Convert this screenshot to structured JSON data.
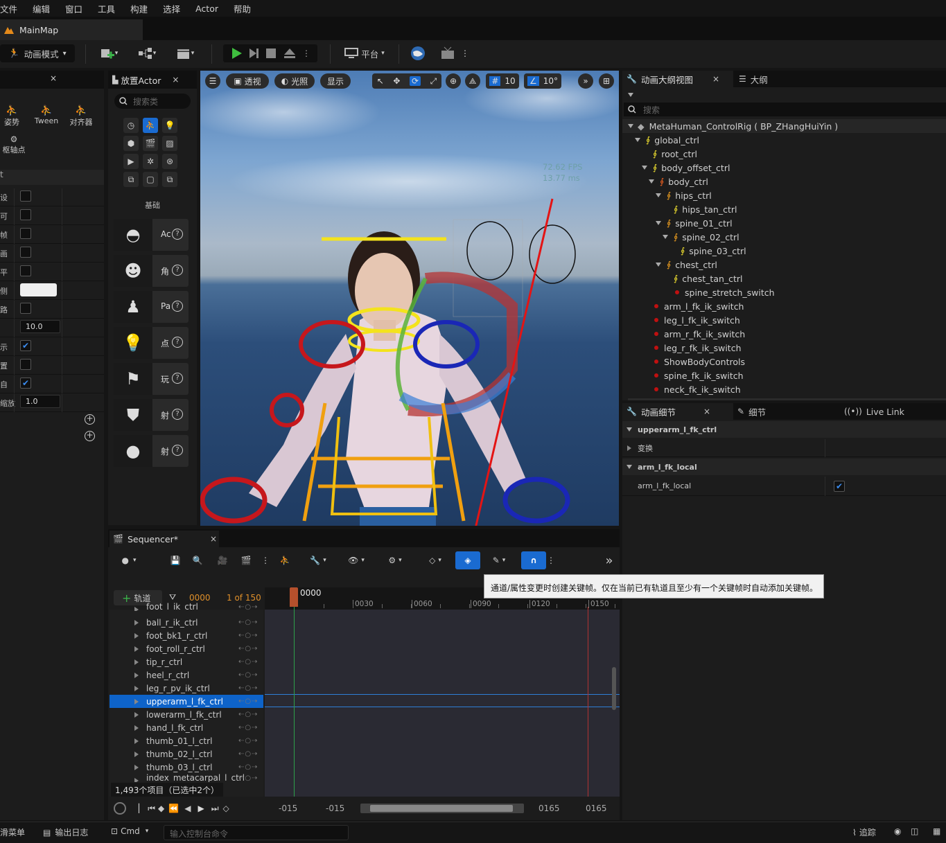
{
  "menu": [
    "文件",
    "编辑",
    "窗口",
    "工具",
    "构建",
    "选择",
    "Actor",
    "帮助"
  ],
  "map_tab": "MainMap",
  "toolbar": {
    "mode": "动画模式",
    "platform": "平台"
  },
  "left_panel": {
    "tools": [
      "姿势",
      "Tween",
      "对齐器"
    ],
    "pivot": "枢轴点",
    "section_header": "t",
    "field_10": "10.0",
    "field_1": "1.0",
    "prop_prefixes": [
      "设",
      "可",
      "帧",
      "画",
      "平",
      "侧",
      "路",
      "",
      "示",
      "置",
      "自",
      "缩放"
    ]
  },
  "place_actor": {
    "title": "放置Actor",
    "search_placeholder": "搜索类",
    "category": "基础",
    "items": [
      "Ac",
      "角",
      "Pa",
      "点",
      "玩",
      "射",
      "射"
    ]
  },
  "viewport": {
    "buttons": {
      "perspective": "透视",
      "lit": "光照",
      "show": "显示",
      "grid": "10",
      "angle": "10°"
    },
    "fps": "72.62 FPS",
    "ms": "13.77 ms"
  },
  "outliner": {
    "tab1": "动画大纲视图",
    "tab2": "大纲",
    "search_placeholder": "搜索",
    "root": "MetaHuman_ControlRig ( BP_ZHangHuiYin )",
    "items": [
      "global_ctrl",
      "root_ctrl",
      "body_offset_ctrl",
      "body_ctrl",
      "hips_ctrl",
      "hips_tan_ctrl",
      "spine_01_ctrl",
      "spine_02_ctrl",
      "spine_03_ctrl",
      "chest_ctrl",
      "chest_tan_ctrl",
      "spine_stretch_switch",
      "arm_l_fk_ik_switch",
      "leg_l_fk_ik_switch",
      "arm_r_fk_ik_switch",
      "leg_r_fk_ik_switch",
      "ShowBodyControls",
      "spine_fk_ik_switch",
      "neck_fk_ik_switch"
    ]
  },
  "details": {
    "tab1": "动画细节",
    "tab2": "细节",
    "tab3": "Live Link",
    "group1": "upperarm_l_fk_ctrl",
    "transform": "变换",
    "group2": "arm_l_fk_local",
    "prop": "arm_l_fk_local"
  },
  "sequencer": {
    "title": "Sequencer*",
    "track_button": "轨道",
    "frame": "0000",
    "of_total": "1 of 150",
    "playhead": "0000",
    "ticks": [
      "0030",
      "0060",
      "0090",
      "0120",
      "0150"
    ],
    "tracks": [
      "foot_l_ik_ctrl",
      "ball_r_ik_ctrl",
      "foot_bk1_r_ctrl",
      "foot_roll_r_ctrl",
      "tip_r_ctrl",
      "heel_r_ctrl",
      "leg_r_pv_ik_ctrl",
      "upperarm_l_fk_ctrl",
      "lowerarm_l_fk_ctrl",
      "hand_l_fk_ctrl",
      "thumb_01_l_ctrl",
      "thumb_02_l_ctrl",
      "thumb_03_l_ctrl",
      "index_metacarpal_l_ctrl"
    ],
    "count": "1,493个项目（已选中2个）",
    "range": [
      "-015",
      "-015",
      "0165",
      "0165"
    ],
    "tooltip": "通道/属性变更时创建关键帧。仅在当前已有轨道且至少有一个关键帧时自动添加关键帧。"
  },
  "statusbar": {
    "drawer": "滑菜单",
    "log": "输出日志",
    "cmd": "Cmd",
    "cmd_placeholder": "输入控制台命令",
    "trace": "追踪"
  }
}
